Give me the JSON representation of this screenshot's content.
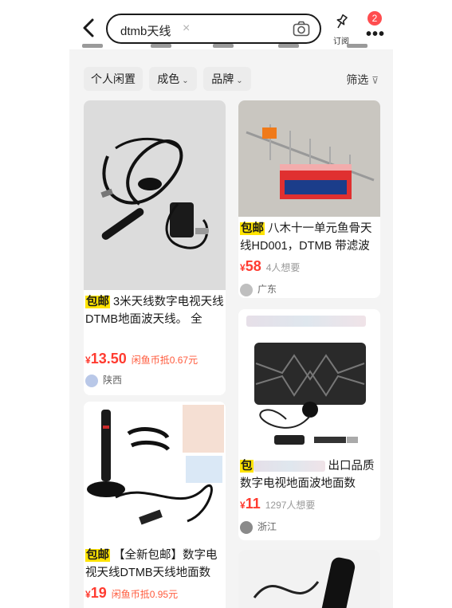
{
  "header": {
    "search_query": "dtmb天线",
    "clear_symbol": "×",
    "subscribe_label": "订阅",
    "badge_count": "2",
    "more_label": "•••"
  },
  "filters": {
    "chips": [
      {
        "label": "个人闲置",
        "arrow": ""
      },
      {
        "label": "成色",
        "arrow": "⌄"
      },
      {
        "label": "品牌",
        "arrow": "⌄"
      }
    ],
    "filter_label": "筛选",
    "filter_icon": "⊽"
  },
  "products": [
    {
      "tag": "包邮",
      "title": "3米天线数字电视天线DTMB地面波天线。 全",
      "title_extra": "全",
      "price_symbol": "¥",
      "price": "13.50",
      "meta": "闲鱼币抵0.67元",
      "location": "陕西"
    },
    {
      "tag": "包邮",
      "title": "八木十一单元鱼骨天线HD001，DTMB 带滤波",
      "price_symbol": "¥",
      "price": "58",
      "meta": "4人想要",
      "location": "广东"
    },
    {
      "tag": "包邮",
      "title": "【全新包邮】数字电视天线DTMB天线地面数",
      "price_symbol": "¥",
      "price": "19",
      "meta": "闲鱼币抵0.95元"
    },
    {
      "tag": "包",
      "title": "出口品质数字电视地面波地面数",
      "price_symbol": "¥",
      "price": "11",
      "meta": "1297人想要",
      "location": "浙江"
    }
  ],
  "colors": {
    "accent_red": "#ff3b30",
    "tag_yellow": "#ffe400",
    "badge_red": "#ff4d4f"
  }
}
